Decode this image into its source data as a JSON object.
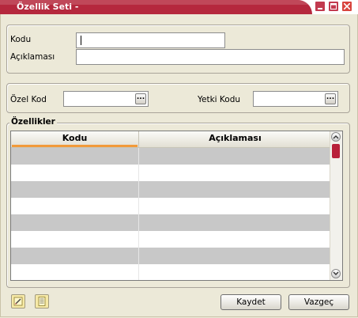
{
  "window": {
    "title": "Özellik Seti -"
  },
  "header": {
    "kodu_label": "Kodu",
    "kodu_value": "",
    "aciklama_label": "Açıklaması",
    "aciklama_value": ""
  },
  "codes": {
    "ozel_kod_label": "Özel Kod",
    "ozel_kod_value": "",
    "yetki_kodu_label": "Yetki Kodu",
    "yetki_kodu_value": "",
    "lookup_button_label": "..."
  },
  "ozellikler": {
    "group_label": "Özellikler",
    "columns": [
      "Kodu",
      "Açıklaması"
    ],
    "rows": [
      [
        "",
        ""
      ],
      [
        "",
        ""
      ],
      [
        "",
        ""
      ],
      [
        "",
        ""
      ],
      [
        "",
        ""
      ],
      [
        "",
        ""
      ],
      [
        "",
        ""
      ],
      [
        "",
        ""
      ]
    ]
  },
  "footer": {
    "save_label": "Kaydet",
    "cancel_label": "Vazgeç"
  },
  "colors": {
    "title_bar": "#b5283d",
    "accent": "#f29a3a"
  }
}
